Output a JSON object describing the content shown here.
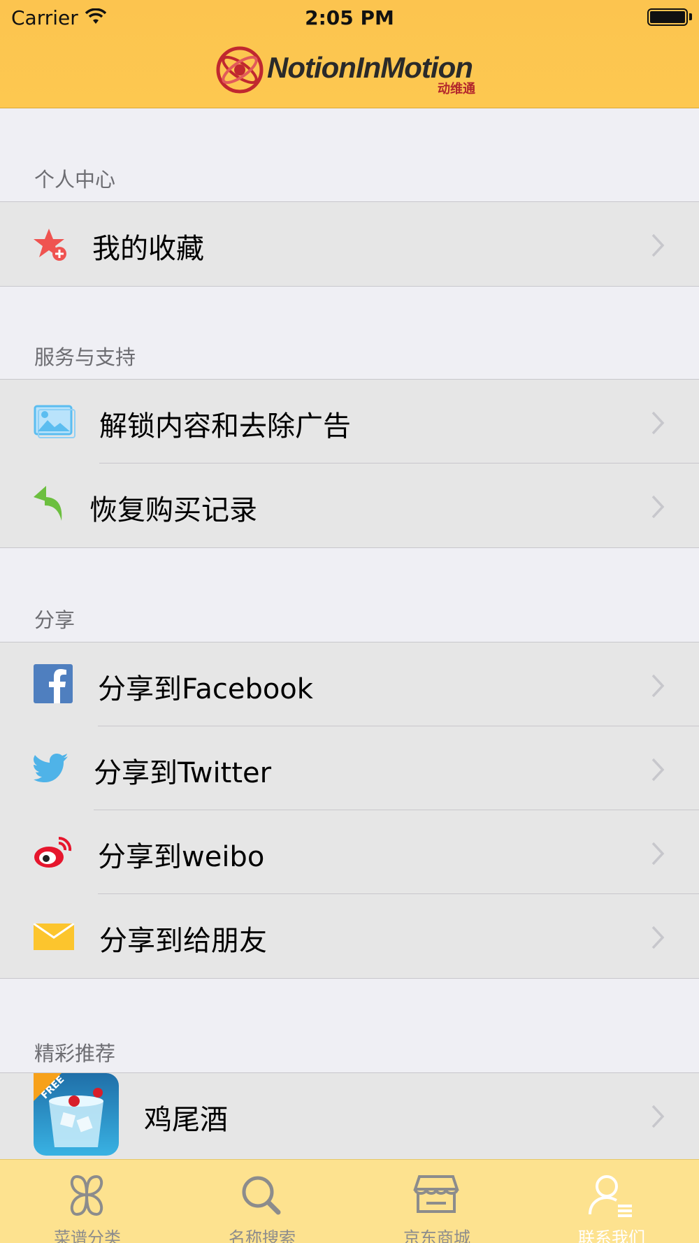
{
  "status_bar": {
    "carrier": "Carrier",
    "time": "2:05 PM"
  },
  "header": {
    "logo_text": "NotionInMotion",
    "logo_sub": "动维通"
  },
  "sections": {
    "personal": {
      "title": "个人中心",
      "items": [
        {
          "label": "我的收藏",
          "icon": "star-plus-icon"
        }
      ]
    },
    "service": {
      "title": "服务与支持",
      "items": [
        {
          "label": "解锁内容和去除广告",
          "icon": "image-icon"
        },
        {
          "label": "恢复购买记录",
          "icon": "reply-arrow-icon"
        }
      ]
    },
    "share": {
      "title": "分享",
      "items": [
        {
          "label": "分享到Facebook",
          "icon": "facebook-icon"
        },
        {
          "label": "分享到Twitter",
          "icon": "twitter-icon"
        },
        {
          "label": "分享到weibo",
          "icon": "weibo-icon"
        },
        {
          "label": "分享到给朋友",
          "icon": "mail-icon"
        }
      ]
    },
    "featured": {
      "title": "精彩推荐",
      "items": [
        {
          "label": "鸡尾酒",
          "icon": "cocktail-app-icon",
          "badge": "FREE"
        }
      ]
    }
  },
  "tabbar": {
    "items": [
      {
        "label": "菜谱分类",
        "icon": "clover-icon",
        "active": false
      },
      {
        "label": "名称搜索",
        "icon": "search-icon",
        "active": false
      },
      {
        "label": "京东商城",
        "icon": "store-icon",
        "active": false
      },
      {
        "label": "联系我们",
        "icon": "person-icon",
        "active": true
      }
    ]
  },
  "colors": {
    "header": "#fcc44f",
    "tabbar": "#fde28f",
    "background": "#efeff4",
    "row": "#e6e6e6"
  }
}
